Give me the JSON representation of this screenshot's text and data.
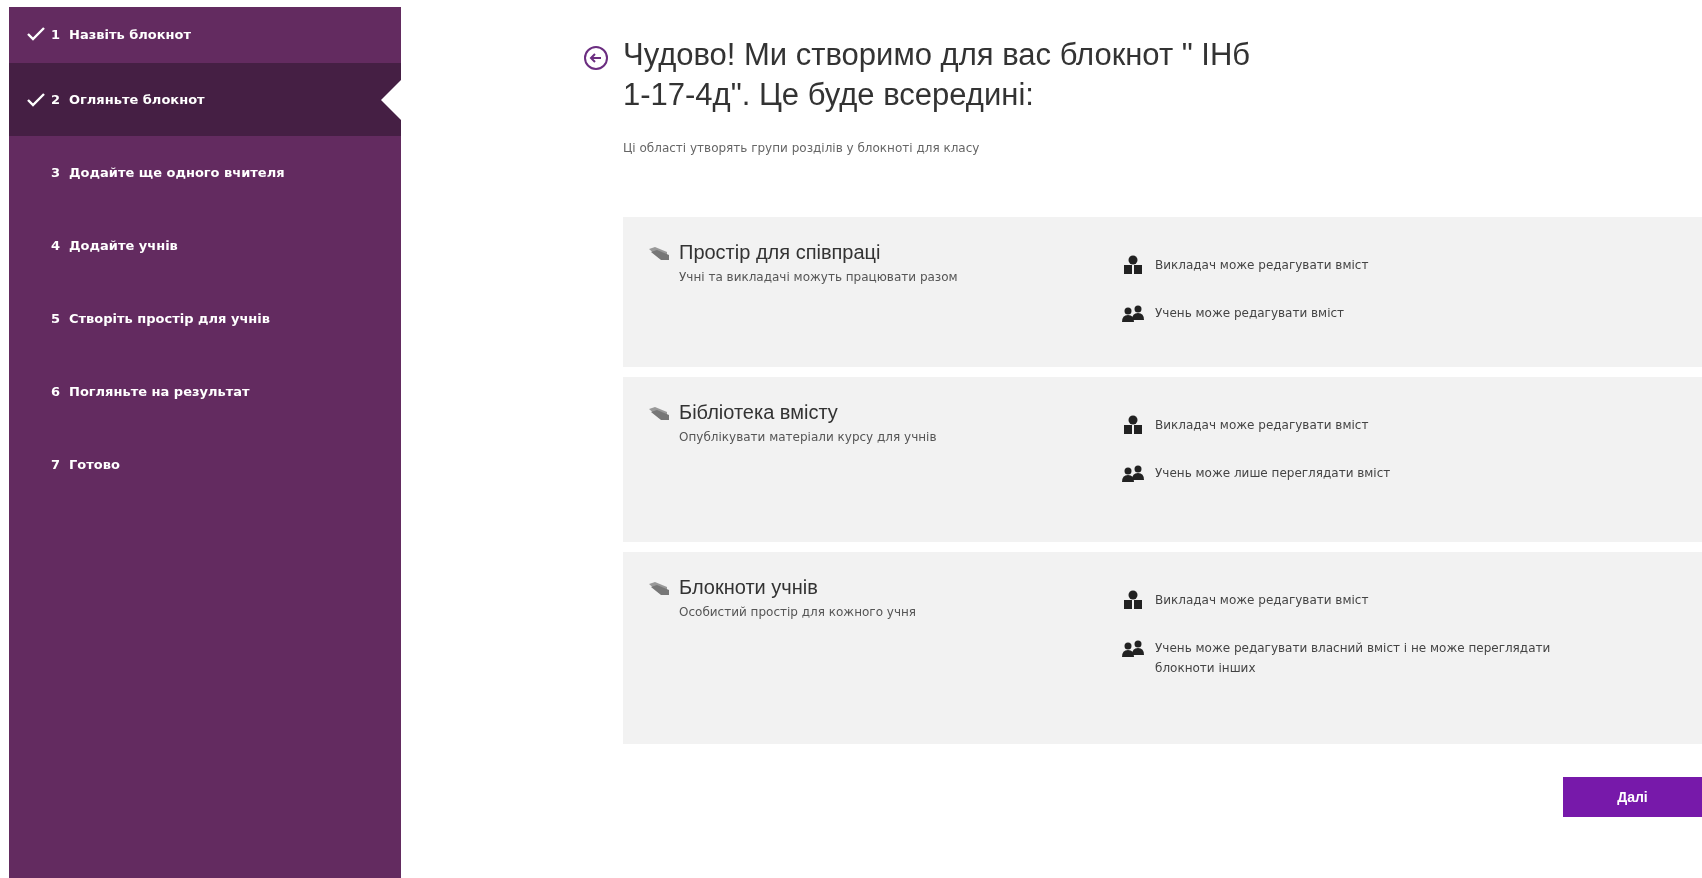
{
  "steps": [
    {
      "number": "1",
      "label": "Назвіть блокнот",
      "completed": true,
      "selected": false
    },
    {
      "number": "2",
      "label": "Огляньте блокнот",
      "completed": true,
      "selected": true
    },
    {
      "number": "3",
      "label": "Додайте ще одного вчителя",
      "completed": false,
      "selected": false
    },
    {
      "number": "4",
      "label": "Додайте учнів",
      "completed": false,
      "selected": false
    },
    {
      "number": "5",
      "label": "Створіть простір для учнів",
      "completed": false,
      "selected": false
    },
    {
      "number": "6",
      "label": "Погляньте на результат",
      "completed": false,
      "selected": false
    },
    {
      "number": "7",
      "label": "Готово",
      "completed": false,
      "selected": false
    }
  ],
  "title": "Чудово! Ми створимо для вас блокнот \" ІНб 1-17-4д\". Це буде всередині:",
  "subtitle": "Ці області утворять групи розділів у блокноті для класу",
  "sections": [
    {
      "title": "Простір для співпраці",
      "description": "Учні та викладачі можуть працювати разом",
      "permissions": [
        {
          "kind": "teacher",
          "text": "Викладач може редагувати вміст"
        },
        {
          "kind": "student",
          "text": "Учень може редагувати вміст"
        }
      ]
    },
    {
      "title": "Бібліотека вмісту",
      "description": "Опублікувати матеріали курсу для учнів",
      "permissions": [
        {
          "kind": "teacher",
          "text": "Викладач може редагувати вміст"
        },
        {
          "kind": "student",
          "text": "Учень може лише переглядати вміст"
        }
      ]
    },
    {
      "title": "Блокноти учнів",
      "description": "Особистий простір для кожного учня",
      "permissions": [
        {
          "kind": "teacher",
          "text": "Викладач може редагувати вміст"
        },
        {
          "kind": "student",
          "text": "Учень може редагувати власний вміст і не може переглядати блокноти інших"
        }
      ]
    }
  ],
  "next_button": "Далі"
}
